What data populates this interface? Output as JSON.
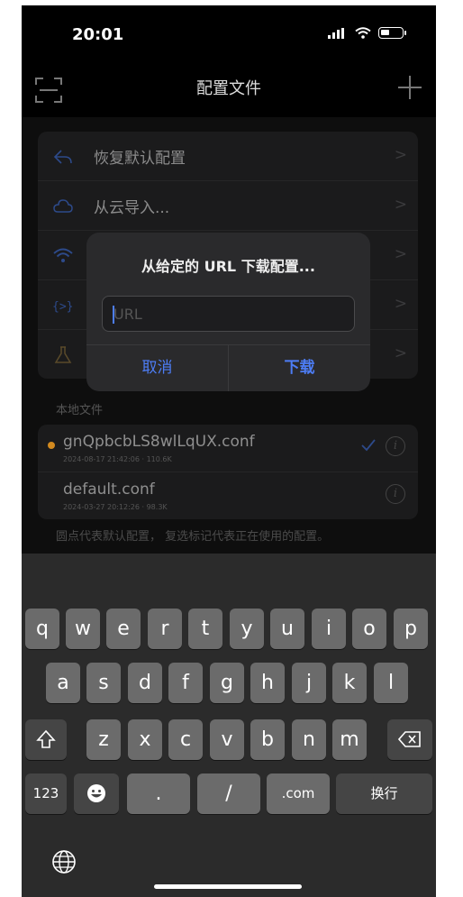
{
  "status_bar": {
    "time": "20:01"
  },
  "nav": {
    "title": "配置文件"
  },
  "menu": [
    {
      "label": "恢复默认配置",
      "icon": "undo-arrow-icon"
    },
    {
      "label": "从云导入...",
      "icon": "cloud-icon"
    },
    {
      "label": "",
      "icon": "wifi-icon"
    },
    {
      "label": "",
      "icon": "code-braces-icon"
    },
    {
      "label": "",
      "icon": "flask-icon"
    }
  ],
  "local_files": {
    "header": "本地文件",
    "files": [
      {
        "name": "gnQpbcbLS8wlLqUX.conf",
        "meta": "2024-08-17 21:42:06 · 110.6K",
        "default": true,
        "active": true
      },
      {
        "name": "default.conf",
        "meta": "2024-03-27 20:12:26 · 98.3K",
        "default": false,
        "active": false
      }
    ],
    "note": "圆点代表默认配置， 复选标记代表正在使用的配置。"
  },
  "alert": {
    "title": "从给定的 URL 下载配置...",
    "input_placeholder": "URL",
    "input_value": "",
    "cancel": "取消",
    "confirm": "下载"
  },
  "keyboard": {
    "row1": [
      "q",
      "w",
      "e",
      "r",
      "t",
      "y",
      "u",
      "i",
      "o",
      "p"
    ],
    "row2": [
      "a",
      "s",
      "d",
      "f",
      "g",
      "h",
      "j",
      "k",
      "l"
    ],
    "row3": [
      "z",
      "x",
      "c",
      "v",
      "b",
      "n",
      "m"
    ],
    "row4": {
      "numbers": "123",
      "dot": ".",
      "slash": "/",
      "dotcom": ".com",
      "return": "换行"
    }
  },
  "colors": {
    "accent": "#4d7df5",
    "default_dot": "#d28a1f"
  }
}
